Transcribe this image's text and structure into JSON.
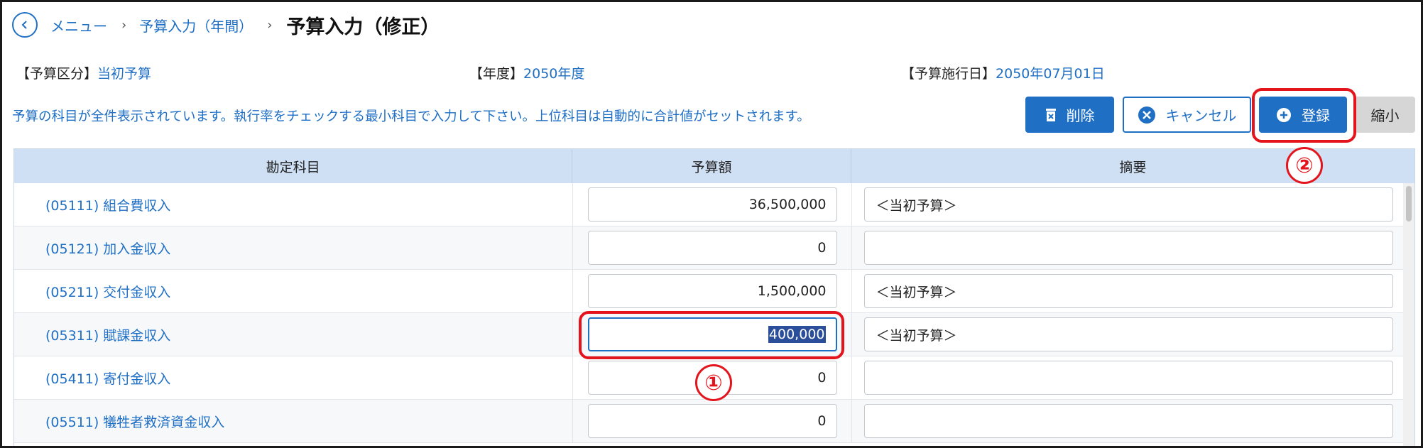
{
  "breadcrumb": {
    "items": [
      "メニュー",
      "予算入力（年間）"
    ],
    "separator": "›",
    "title": "予算入力（修正）"
  },
  "info": {
    "budget_type_label": "【予算区分】",
    "budget_type_value": "当初予算",
    "year_label": "【年度】",
    "year_value": "2050年度",
    "start_date_label": "【予算施行日】",
    "start_date_value": "2050年07月01日"
  },
  "notice": "予算の科目が全件表示されています。執行率をチェックする最小科目で入力して下さい。上位科目は自動的に合計値がセットされます。",
  "buttons": {
    "delete": "削除",
    "cancel": "キャンセル",
    "register": "登録",
    "shrink": "縮小"
  },
  "annotations": [
    "①",
    "②"
  ],
  "table": {
    "headers": [
      "勘定科目",
      "予算額",
      "摘要"
    ],
    "rows": [
      {
        "account": "(05111) 組合費収入",
        "amount": "36,500,000",
        "memo": "＜当初予算＞"
      },
      {
        "account": "(05121) 加入金収入",
        "amount": "0",
        "memo": ""
      },
      {
        "account": "(05211) 交付金収入",
        "amount": "1,500,000",
        "memo": "＜当初予算＞"
      },
      {
        "account": "(05311) 賦課金収入",
        "amount": "400,000",
        "memo": "＜当初予算＞"
      },
      {
        "account": "(05411) 寄付金収入",
        "amount": "0",
        "memo": ""
      },
      {
        "account": "(05511) 犠牲者救済資金収入",
        "amount": "0",
        "memo": ""
      }
    ]
  },
  "colors": {
    "accent": "#1f6fc5",
    "annotation": "#e3141b",
    "header_bg": "#cfe0f5"
  }
}
